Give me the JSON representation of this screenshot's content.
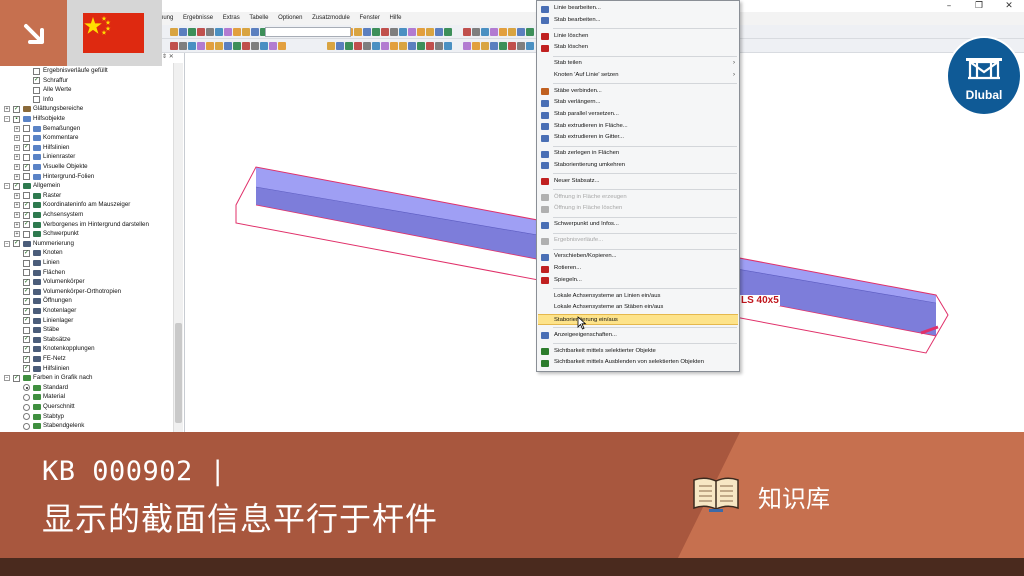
{
  "menubar": [
    "nung",
    "Ergebnisse",
    "Extras",
    "Tabelle",
    "Optionen",
    "Zusatzmodule",
    "Fenster",
    "Hilfe"
  ],
  "window_controls": [
    "–",
    "❐",
    "✕"
  ],
  "navigator": {
    "header": "⇕ ✕",
    "rows": [
      {
        "label": "Ergebnisverläufe gefüllt",
        "level": 2,
        "check": "off",
        "icon": "none"
      },
      {
        "label": "Schraffur",
        "level": 2,
        "check": "on",
        "icon": "none"
      },
      {
        "label": "Alle Werte",
        "level": 2,
        "check": "off",
        "icon": "none"
      },
      {
        "label": "Info",
        "level": 2,
        "check": "off",
        "icon": "none"
      },
      {
        "label": "Glättungsbereiche",
        "level": 0,
        "check": "on",
        "icon": "smooth",
        "exp": "+"
      },
      {
        "label": "Hilfsobjekte",
        "level": 0,
        "check": "partial",
        "icon": "pin",
        "exp": "−"
      },
      {
        "label": "Bemaßungen",
        "level": 1,
        "check": "off",
        "icon": "pin",
        "exp": "+"
      },
      {
        "label": "Kommentare",
        "level": 1,
        "check": "off",
        "icon": "pin",
        "exp": "+"
      },
      {
        "label": "Hilfslinien",
        "level": 1,
        "check": "on",
        "icon": "pin",
        "exp": "+"
      },
      {
        "label": "Linienraster",
        "level": 1,
        "check": "off",
        "icon": "pin",
        "exp": "+"
      },
      {
        "label": "Visuelle Objekte",
        "level": 1,
        "check": "on",
        "icon": "pin",
        "exp": "+"
      },
      {
        "label": "Hintergrund-Folien",
        "level": 1,
        "check": "off",
        "icon": "pin",
        "exp": "+"
      },
      {
        "label": "Allgemein",
        "level": 0,
        "check": "on",
        "icon": "general",
        "exp": "−"
      },
      {
        "label": "Raster",
        "level": 1,
        "check": "off",
        "icon": "general",
        "exp": "+"
      },
      {
        "label": "Koordinateninfo am Mauszeiger",
        "level": 1,
        "check": "on",
        "icon": "general",
        "exp": "+"
      },
      {
        "label": "Achsensystem",
        "level": 1,
        "check": "on",
        "icon": "general",
        "exp": "+"
      },
      {
        "label": "Verborgenes im Hintergrund darstellen",
        "level": 1,
        "check": "on",
        "icon": "general",
        "exp": "+"
      },
      {
        "label": "Schwerpunkt",
        "level": 1,
        "check": "off",
        "icon": "general",
        "exp": "+"
      },
      {
        "label": "Nummerierung",
        "level": 0,
        "check": "on",
        "icon": "num",
        "exp": "−"
      },
      {
        "label": "Knoten",
        "level": 1,
        "check": "on",
        "icon": "num"
      },
      {
        "label": "Linien",
        "level": 1,
        "check": "off",
        "icon": "num"
      },
      {
        "label": "Flächen",
        "level": 1,
        "check": "off",
        "icon": "num"
      },
      {
        "label": "Volumenkörper",
        "level": 1,
        "check": "on",
        "icon": "num"
      },
      {
        "label": "Volumenkörper-Orthotropien",
        "level": 1,
        "check": "on",
        "icon": "num"
      },
      {
        "label": "Öffnungen",
        "level": 1,
        "check": "on",
        "icon": "num"
      },
      {
        "label": "Knotenlager",
        "level": 1,
        "check": "on",
        "icon": "num"
      },
      {
        "label": "Linienlager",
        "level": 1,
        "check": "on",
        "icon": "num"
      },
      {
        "label": "Stäbe",
        "level": 1,
        "check": "off",
        "icon": "num"
      },
      {
        "label": "Stabsätze",
        "level": 1,
        "check": "on",
        "icon": "num"
      },
      {
        "label": "Knotenkopplungen",
        "level": 1,
        "check": "on",
        "icon": "num"
      },
      {
        "label": "FE-Netz",
        "level": 1,
        "check": "on",
        "icon": "num"
      },
      {
        "label": "Hilfslinien",
        "level": 1,
        "check": "on",
        "icon": "num"
      },
      {
        "label": "Farben in Grafik nach",
        "level": 0,
        "check": "on",
        "icon": "color",
        "exp": "−"
      },
      {
        "label": "Standard",
        "level": 1,
        "radio": "on",
        "icon": "color"
      },
      {
        "label": "Material",
        "level": 1,
        "radio": "off",
        "icon": "color"
      },
      {
        "label": "Querschnitt",
        "level": 1,
        "radio": "off",
        "icon": "color"
      },
      {
        "label": "Stabtyp",
        "level": 1,
        "radio": "off",
        "icon": "color"
      },
      {
        "label": "Stabendgelenk",
        "level": 1,
        "radio": "off",
        "icon": "color"
      }
    ]
  },
  "context_menu": {
    "items": [
      {
        "label": "Linie bearbeiten...",
        "icon": "edit-line",
        "color": "#4a6fb5"
      },
      {
        "label": "Stab bearbeiten...",
        "icon": "edit-member",
        "color": "#4a6fb5"
      },
      {
        "sep": true
      },
      {
        "label": "Linie löschen",
        "icon": "delete-line",
        "color": "#c02020"
      },
      {
        "label": "Stab löschen",
        "icon": "delete-member",
        "color": "#c02020"
      },
      {
        "sep": true
      },
      {
        "label": "Stab teilen",
        "arrow": "›"
      },
      {
        "label": "Knoten 'Auf Linie' setzen",
        "arrow": "›"
      },
      {
        "sep": true
      },
      {
        "label": "Stäbe verbinden...",
        "icon": "connect",
        "color": "#c06020"
      },
      {
        "label": "Stab verlängern...",
        "icon": "extend",
        "color": "#4a6fb5"
      },
      {
        "label": "Stab parallel versetzen...",
        "icon": "offset",
        "color": "#4a6fb5"
      },
      {
        "label": "Stab extrudieren in Fläche...",
        "icon": "extrude-surface",
        "color": "#4a6fb5"
      },
      {
        "label": "Stab extrudieren in Gitter...",
        "icon": "extrude-grid",
        "color": "#4a6fb5"
      },
      {
        "sep": true
      },
      {
        "label": "Stab zerlegen in Flächen",
        "icon": "decompose",
        "color": "#4a6fb5"
      },
      {
        "label": "Staborientierung umkehren",
        "icon": "reverse",
        "color": "#4a6fb5"
      },
      {
        "sep": true
      },
      {
        "label": "Neuer Stabsatz...",
        "icon": "new-set",
        "color": "#c02020"
      },
      {
        "sep": true
      },
      {
        "label": "Öffnung in Fläche erzeugen",
        "icon": "opening",
        "color": "#b0b0b0",
        "disabled": true
      },
      {
        "label": "Öffnung in Fläche löschen",
        "icon": "opening-delete",
        "color": "#b0b0b0",
        "disabled": true
      },
      {
        "sep": true
      },
      {
        "label": "Schwerpunkt und Infos...",
        "icon": "centroid",
        "color": "#4a6fb5"
      },
      {
        "sep": true
      },
      {
        "label": "Ergebnisverläufe...",
        "icon": "results",
        "color": "#b0b0b0",
        "disabled": true
      },
      {
        "sep": true
      },
      {
        "label": "Verschieben/Kopieren...",
        "icon": "move",
        "color": "#4a6fb5"
      },
      {
        "label": "Rotieren...",
        "icon": "rotate",
        "color": "#c02020"
      },
      {
        "label": "Spiegeln...",
        "icon": "mirror",
        "color": "#c02020"
      },
      {
        "sep": true
      },
      {
        "label": "Lokale Achsensysteme an Linien ein/aus",
        "icon": "none"
      },
      {
        "label": "Lokale Achsensysteme an Stäben ein/aus",
        "icon": "none"
      },
      {
        "label": "Staborientierung ein/aus",
        "icon": "none",
        "highlight": true
      },
      {
        "sep": true
      },
      {
        "label": "Anzeigeeigenschaften...",
        "icon": "display",
        "color": "#4a6fb5"
      },
      {
        "sep": true
      },
      {
        "label": "Sichtbarkeit mittels selektierter Objekte",
        "icon": "visibility",
        "color": "#2d7d2d"
      },
      {
        "label": "Sichtbarkeit mittels Ausblenden von selektierten Objekten",
        "icon": "visibility-hide",
        "color": "#2d7d2d"
      }
    ]
  },
  "viewport": {
    "dimension_label": "LS 40x5",
    "member_color": "#8e8ef2",
    "outline_color": "#e0306a"
  },
  "brand": {
    "logo_text": "Dlubal",
    "accent": "#c6704f",
    "banner": "#a8573e",
    "logo_blue": "#0f5a96"
  },
  "banner": {
    "code": "KB 000902 |",
    "title": "显示的截面信息平行于杆件",
    "category": "知识库"
  }
}
